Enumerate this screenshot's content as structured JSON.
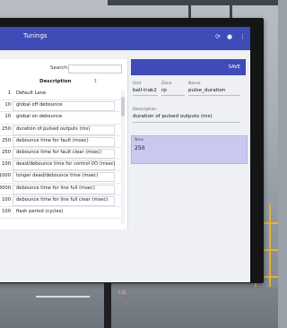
{
  "app": {
    "title": "Tunings",
    "icons": [
      "refresh-icon",
      "user-icon",
      "more-icon"
    ],
    "accent": "#3f4bb6"
  },
  "left_panel": {
    "search_label": "Search:",
    "search_placeholder": "",
    "headers": {
      "col1": "",
      "col2": "Description",
      "col3": "↕"
    },
    "rows": [
      {
        "value": "1",
        "description": "Default Lane"
      },
      {
        "value": "10",
        "description": "global off debounce"
      },
      {
        "value": "10",
        "description": "global on debounce"
      },
      {
        "value": "250",
        "description": "duration of pulsed outputs (ms)"
      },
      {
        "value": "250",
        "description": "debounce time for fault (msec)"
      },
      {
        "value": "250",
        "description": "debounce time for fault clear (msec)"
      },
      {
        "value": "100",
        "description": "dead/debounce time for control I/O (msec)"
      },
      {
        "value": "1000",
        "description": "longer dead/debounce time (msec)"
      },
      {
        "value": "3000",
        "description": "debounce time for line full (msec)"
      },
      {
        "value": "100",
        "description": "debounce time for line full clear (msec)"
      },
      {
        "value": "100",
        "description": "flash period (cycles)"
      }
    ]
  },
  "right_panel": {
    "save_label": "SAVE",
    "fields": {
      "unit_label": "Unit",
      "unit_value": "ball-trak2",
      "zone_label": "Zone",
      "zone_value": "rp",
      "name_label": "Name",
      "name_value": "pulse_duration",
      "desc_label": "Description",
      "desc_value": "duration of pulsed outputs (ms)",
      "new_label": "New",
      "new_value": "250"
    }
  },
  "monitor": {
    "brand": "LG"
  }
}
